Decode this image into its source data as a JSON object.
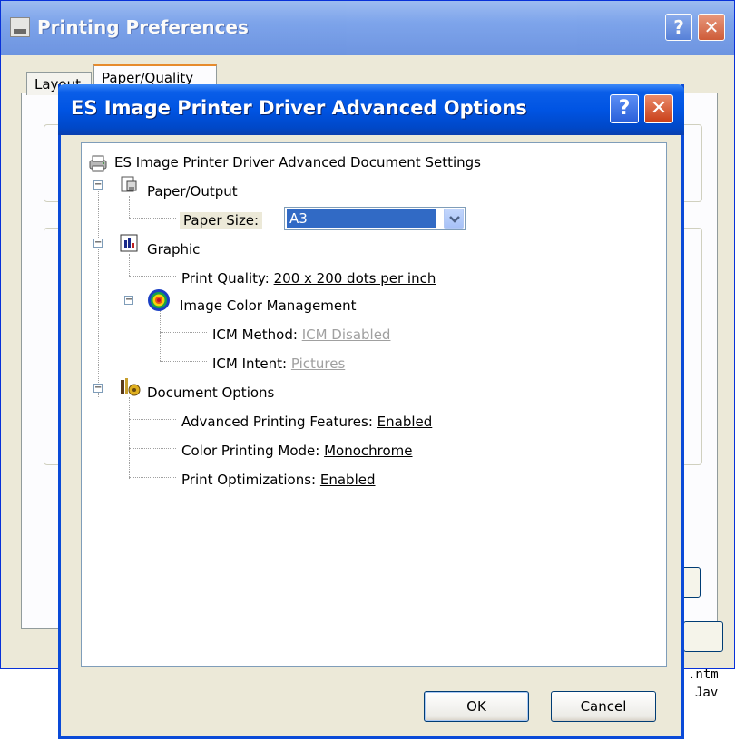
{
  "background_window": {
    "title": "Printing Preferences",
    "help_glyph": "?",
    "close_glyph": "✕",
    "tabs": [
      {
        "label": "Layout"
      },
      {
        "label": "Paper/Quality",
        "selected": true
      }
    ],
    "text_fragments": [
      ".ntm",
      "Jav"
    ]
  },
  "dialog": {
    "title": "ES Image Printer Driver Advanced Options",
    "help_glyph": "?",
    "close_glyph": "✕",
    "tree": {
      "root": "ES Image Printer Driver Advanced Document Settings",
      "paper_output": {
        "label": "Paper/Output",
        "paper_size_label": "Paper Size:",
        "paper_size_value": "A3"
      },
      "graphic": {
        "label": "Graphic",
        "print_quality_label": "Print Quality: ",
        "print_quality_value": "200 x 200 dots per inch",
        "icm": {
          "label": "Image Color Management",
          "method_label": "ICM Method: ",
          "method_value": "ICM Disabled",
          "intent_label": "ICM Intent: ",
          "intent_value": "Pictures"
        }
      },
      "document_options": {
        "label": "Document Options",
        "advanced_label": "Advanced Printing Features: ",
        "advanced_value": "Enabled",
        "color_mode_label": "Color Printing Mode: ",
        "color_mode_value": "Monochrome",
        "optimizations_label": "Print Optimizations: ",
        "optimizations_value": "Enabled"
      }
    },
    "buttons": {
      "ok": "OK",
      "cancel": "Cancel"
    }
  },
  "colors": {
    "title_blue": "#0054e3",
    "selection": "#316ac5",
    "disabled_text": "#a0a0a0",
    "face": "#ece9d8"
  }
}
